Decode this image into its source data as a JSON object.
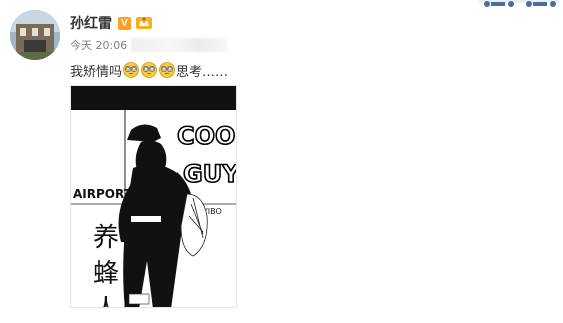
{
  "post": {
    "author_name": "孙红雷",
    "vip_badge": "V",
    "timestamp": "今天 20:06",
    "text_before_emoji": "我矫情吗",
    "emoji_count": 3,
    "emoji_name": "dizzy-eyes-emoji",
    "text_after_emoji": "思考……",
    "image": {
      "headline_1": "COOL",
      "headline_2": "GUY",
      "side_label": "AIRPORT",
      "signature": "WYIBO",
      "chars": [
        "养",
        "蜂",
        "人"
      ]
    }
  },
  "colors": {
    "name": "#333333",
    "meta": "#808080",
    "vip": "#f9a025"
  },
  "icons": {
    "avatar": "user-avatar-photo",
    "member_badge": "member-badge-icon",
    "deco": "motorbike-strip-icon"
  }
}
